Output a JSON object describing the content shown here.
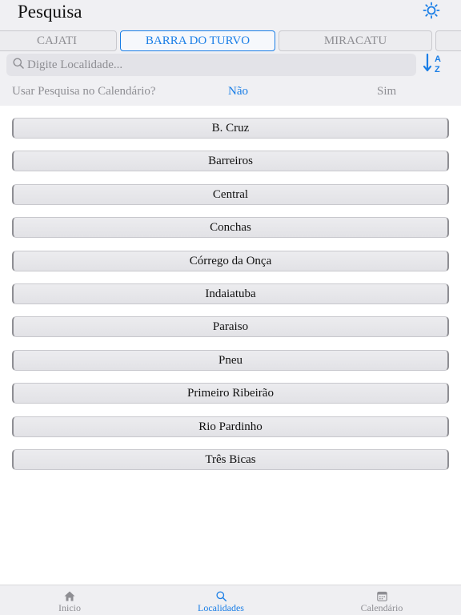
{
  "header": {
    "title": "Pesquisa"
  },
  "tabs": [
    {
      "label": "CAJATI",
      "active": false
    },
    {
      "label": "BARRA DO TURVO",
      "active": true
    },
    {
      "label": "MIRACATU",
      "active": false
    },
    {
      "label": "",
      "active": false
    }
  ],
  "search": {
    "placeholder": "Digite Localidade...",
    "value": ""
  },
  "calendar_toggle": {
    "label": "Usar Pesquisa no Calendário?",
    "options": [
      "Não",
      "Sim"
    ],
    "selected": "Não"
  },
  "localidades": [
    "B. Cruz",
    "Barreiros",
    "Central",
    "Conchas",
    "Córrego da Onça",
    "Indaiatuba",
    "Paraiso",
    "Pneu",
    "Primeiro Ribeirão",
    "Rio Pardinho",
    "Três Bicas"
  ],
  "bottom_nav": [
    {
      "label": "Inicio",
      "icon": "home-icon",
      "active": false
    },
    {
      "label": "Localidades",
      "icon": "search-icon",
      "active": true
    },
    {
      "label": "Calendário",
      "icon": "calendar-icon",
      "active": false
    }
  ],
  "colors": {
    "accent": "#1a7ee6",
    "muted": "#8e8e93",
    "top_background": "#f0f0f3"
  }
}
